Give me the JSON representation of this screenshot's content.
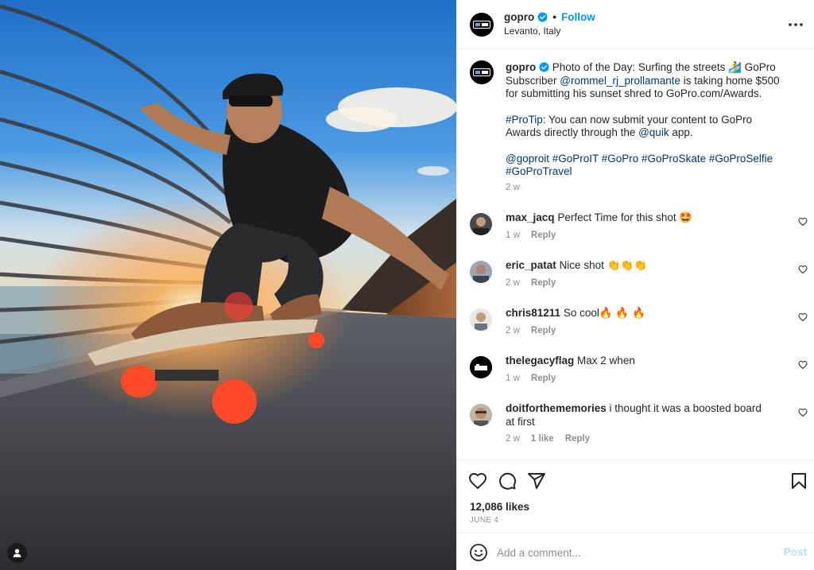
{
  "post": {
    "username": "gopro",
    "verified": true,
    "follow_label": "Follow",
    "separator": "•",
    "location": "Levanto, Italy",
    "more_icon": "more-horizontal-icon"
  },
  "caption": {
    "username": "gopro",
    "line1_text": "Photo of the Day: Surfing the streets ",
    "line1_emoji": "🏄",
    "line1_after": " GoPro Subscriber ",
    "mention1": "@rommel_rj_prollamante",
    "line1_end": " is taking home $500 for submitting his sunset shred to GoPro.com/Awards.",
    "protip_tag": "#ProTip",
    "protip_text": ": You can now submit your content to GoPro Awards directly through the ",
    "mention2": "@quik",
    "protip_end": " app.",
    "tags": "@goproit #GoProIT #GoPro #GoProSkate #GoProSelfie #GoProTravel",
    "time": "2 w"
  },
  "comments": [
    {
      "username": "max_jacq",
      "text": "Perfect Time for this shot 🤩",
      "time": "1 w",
      "likes": "",
      "reply": "Reply"
    },
    {
      "username": "eric_patat",
      "text": "Nice shot 👏👏👏",
      "time": "2 w",
      "likes": "",
      "reply": "Reply"
    },
    {
      "username": "chris81211",
      "text": "So cool🔥 🔥 🔥",
      "time": "2 w",
      "likes": "",
      "reply": "Reply"
    },
    {
      "username": "thelegacyflag",
      "text": "Max 2 when",
      "time": "1 w",
      "likes": "",
      "reply": "Reply"
    },
    {
      "username": "doitforthememories",
      "text": "i thought it was a boosted board at first",
      "time": "2 w",
      "likes": "1 like",
      "reply": "Reply"
    }
  ],
  "actions": {
    "like_icon": "heart-icon",
    "comment_icon": "comment-icon",
    "share_icon": "share-icon",
    "save_icon": "bookmark-icon",
    "likes_count": "12,086 likes",
    "date": "JUNE 4"
  },
  "composer": {
    "placeholder": "Add a comment...",
    "post_label": "Post",
    "emoji_icon": "emoji-icon"
  },
  "colors": {
    "link": "#00376b",
    "accent": "#0095f6",
    "post_disabled": "#b2dffc",
    "muted": "#8e8e8e"
  }
}
